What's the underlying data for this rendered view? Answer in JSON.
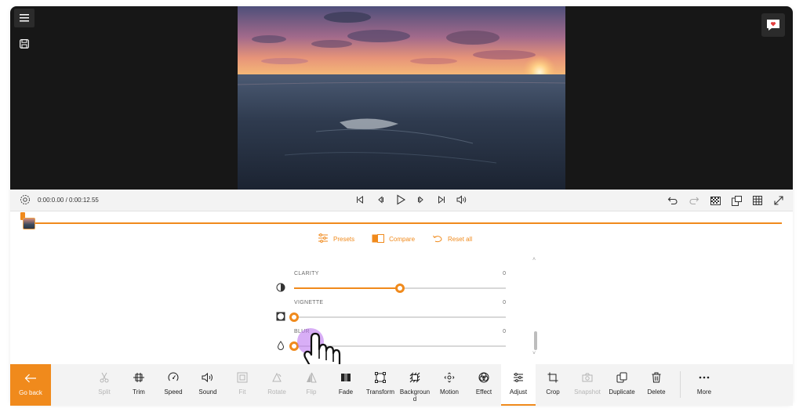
{
  "player": {
    "timecode": "0:00:0.00 / 0:00:12.55"
  },
  "adjust": {
    "presets_label": "Presets",
    "compare_label": "Compare",
    "reset_label": "Reset all",
    "sliders": [
      {
        "label": "CLARITY",
        "value": "0",
        "level": 0.5,
        "icon": "contrast-icon"
      },
      {
        "label": "VIGNETTE",
        "value": "0",
        "level": 0.0,
        "icon": "vignette-icon"
      },
      {
        "label": "BLUR",
        "value": "0",
        "level": 0.0,
        "icon": "drop-icon"
      }
    ]
  },
  "toolbar": {
    "go_back": "Go back",
    "tools": [
      {
        "label": "Split",
        "icon": "scissors-icon",
        "disabled": true
      },
      {
        "label": "Trim",
        "icon": "trim-icon",
        "disabled": false
      },
      {
        "label": "Speed",
        "icon": "speedometer-icon",
        "disabled": false
      },
      {
        "label": "Sound",
        "icon": "speaker-icon",
        "disabled": false
      },
      {
        "label": "Fit",
        "icon": "fit-icon",
        "disabled": true
      },
      {
        "label": "Rotate",
        "icon": "rotate-icon",
        "disabled": true
      },
      {
        "label": "Flip",
        "icon": "flip-icon",
        "disabled": true
      },
      {
        "label": "Fade",
        "icon": "fade-icon",
        "disabled": false
      },
      {
        "label": "Transform",
        "icon": "transform-icon",
        "disabled": false
      },
      {
        "label": "Backgroun d",
        "icon": "background-icon",
        "disabled": false
      },
      {
        "label": "Motion",
        "icon": "motion-icon",
        "disabled": false
      },
      {
        "label": "Effect",
        "icon": "effect-icon",
        "disabled": false
      },
      {
        "label": "Adjust",
        "icon": "adjust-icon",
        "disabled": false,
        "active": true
      },
      {
        "label": "Crop",
        "icon": "crop-icon",
        "disabled": false
      },
      {
        "label": "Snapshot",
        "icon": "camera-icon",
        "disabled": true
      },
      {
        "label": "Duplicate",
        "icon": "duplicate-icon",
        "disabled": false
      },
      {
        "label": "Delete",
        "icon": "trash-icon",
        "disabled": false
      }
    ],
    "more": "More"
  },
  "colors": {
    "accent": "#f08a1c",
    "preview_bg": "#171717",
    "toolbar_bg": "#f3f3f3"
  }
}
